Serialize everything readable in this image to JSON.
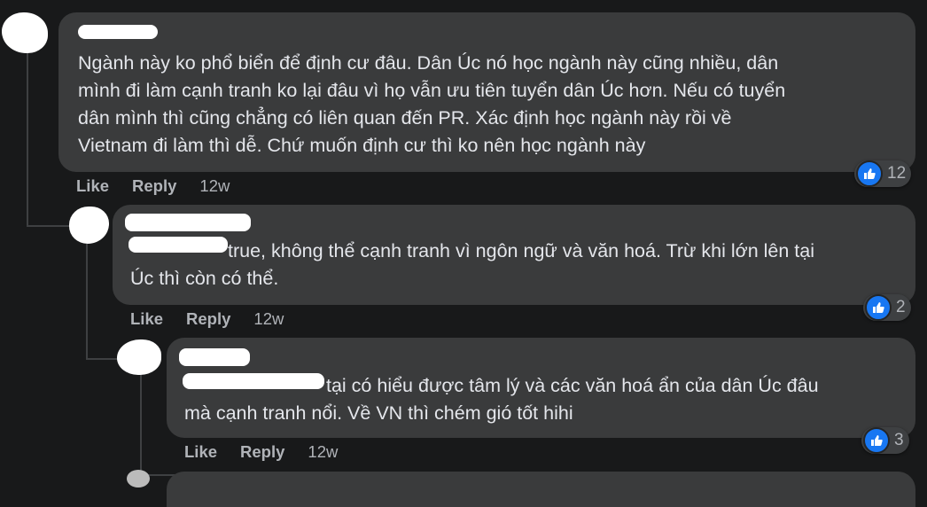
{
  "colors": {
    "background": "#18191a",
    "bubble": "#3a3b3c",
    "text": "#e4e6eb",
    "meta": "#b0b3b8",
    "like_blue": "#1877f2"
  },
  "comments": [
    {
      "text": "Ngành này ko phổ biển để định cư đâu. Dân Úc nó học ngành này cũng nhiều, dân\nmình đi làm cạnh tranh ko lại đâu vì họ vẫn ưu tiên tuyển dân Úc hơn. Nếu có tuyển\ndân mình thì cũng chẳng có liên quan đến PR. Xác định học ngành này rồi về\nVietnam đi làm thì dễ. Chứ muốn định cư thì ko nên học ngành này",
      "like_label": "Like",
      "reply_label": "Reply",
      "time": "12w",
      "reaction_icon": "like-icon",
      "reaction_count": "12"
    },
    {
      "text_after_tag": "true, không thể cạnh tranh vì ngôn ngữ và văn hoá. Trừ khi lớn lên tại",
      "text_line2": "Úc thì còn có thể.",
      "like_label": "Like",
      "reply_label": "Reply",
      "time": "12w",
      "reaction_icon": "like-icon",
      "reaction_count": "2"
    },
    {
      "text_after_tag": "tại có hiểu được tâm lý và các văn hoá ẩn của dân Úc đâu",
      "text_line2": "mà cạnh tranh nổi. Về VN thì chém gió tốt hihi",
      "like_label": "Like",
      "reply_label": "Reply",
      "time": "12w",
      "reaction_icon": "like-icon",
      "reaction_count": "3"
    }
  ]
}
